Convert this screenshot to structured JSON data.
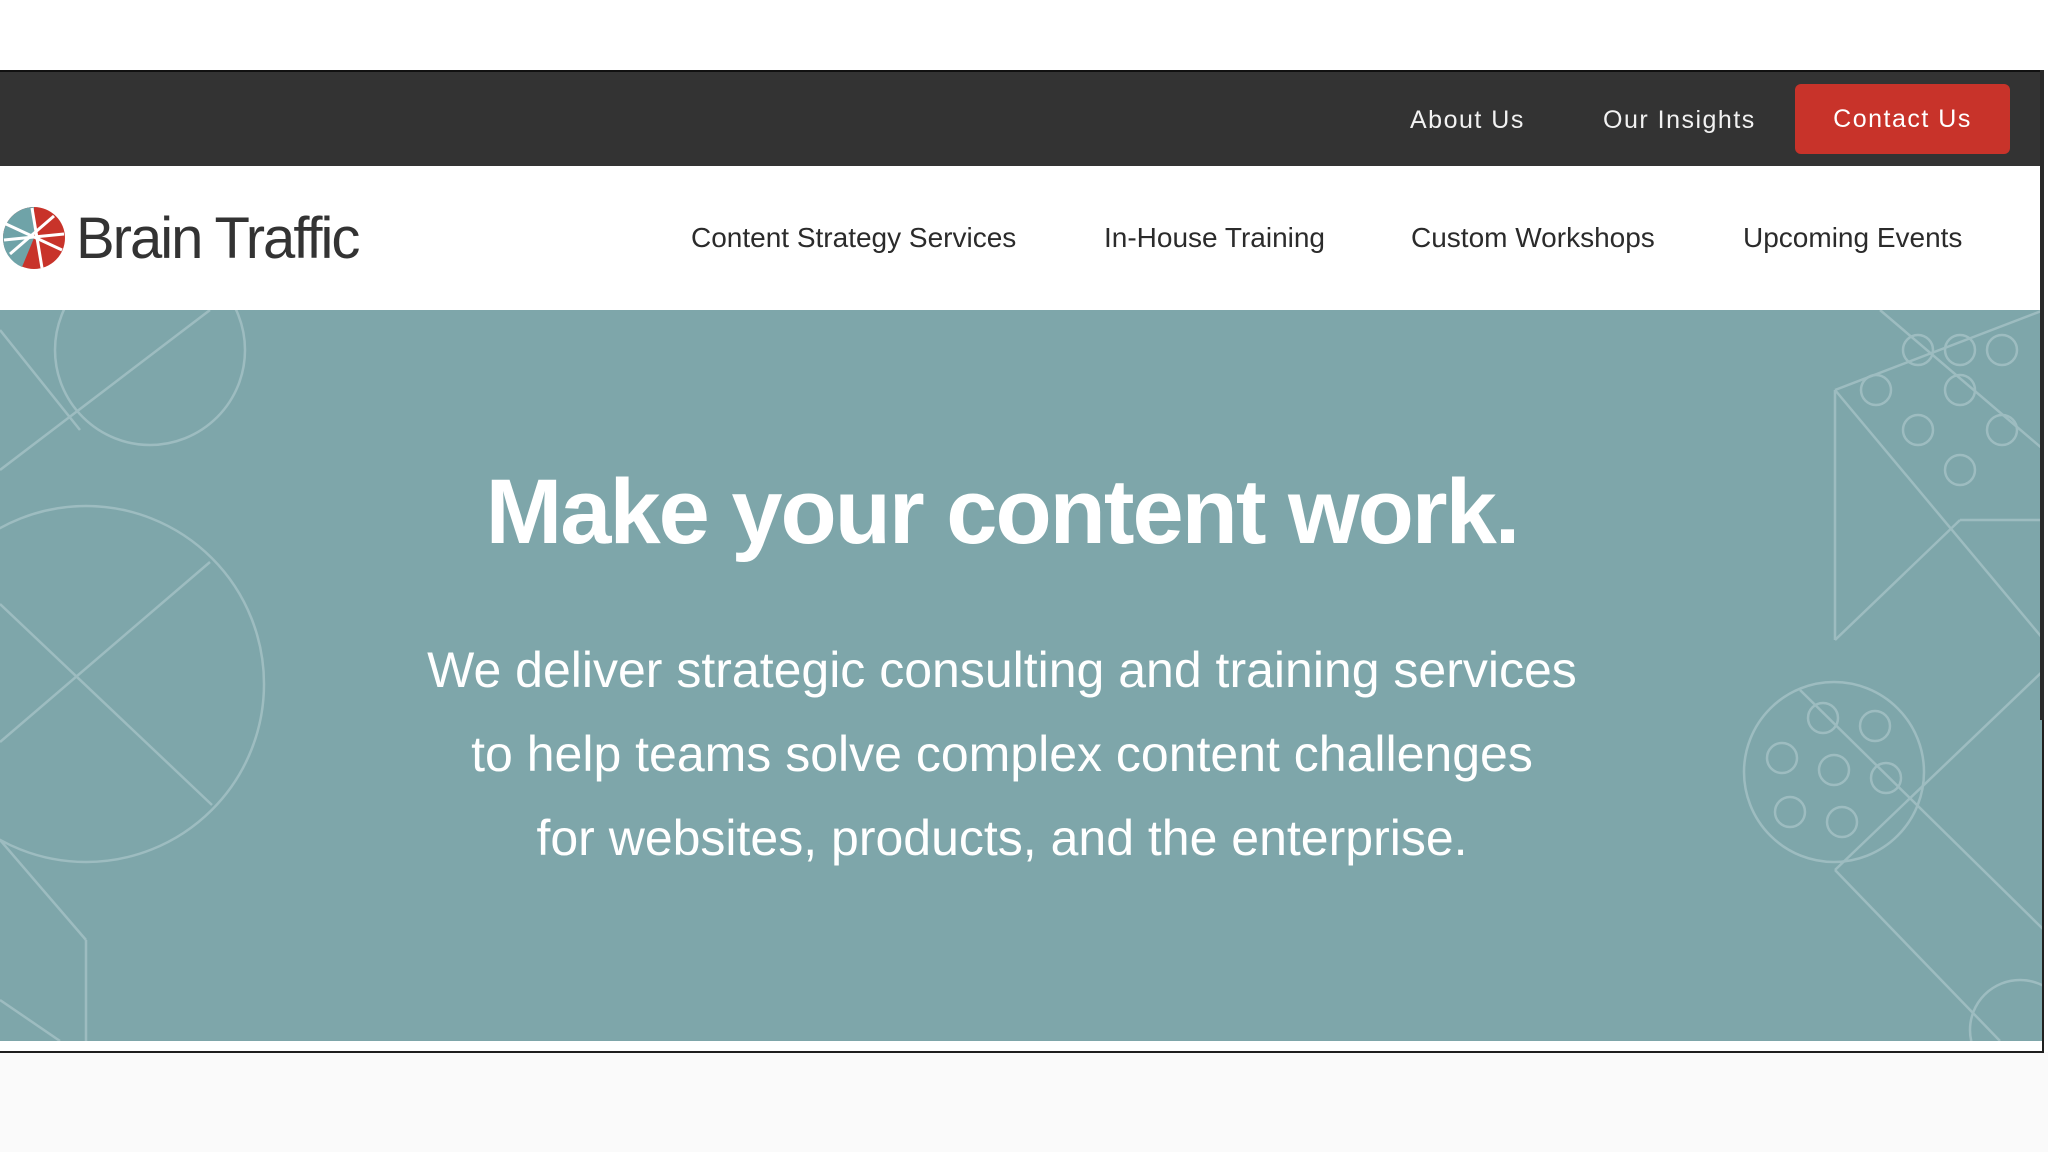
{
  "utility_nav": {
    "about": "About Us",
    "insights": "Our Insights",
    "contact": "Contact Us"
  },
  "brand": {
    "name": "Brain Traffic",
    "colors": {
      "red": "#c8332a",
      "teal": "#6fa3a8",
      "dark": "#333333"
    }
  },
  "main_nav": {
    "items": [
      {
        "label": "Content Strategy Services"
      },
      {
        "label": "In-House Training"
      },
      {
        "label": "Custom Workshops"
      },
      {
        "label": "Upcoming Events"
      }
    ]
  },
  "hero": {
    "title": "Make your content work.",
    "subtitle_lines": [
      "We deliver strategic consulting and training services",
      "to help teams solve complex content challenges",
      "for websites, products, and the enterprise."
    ],
    "background": "#7ea6aa"
  }
}
